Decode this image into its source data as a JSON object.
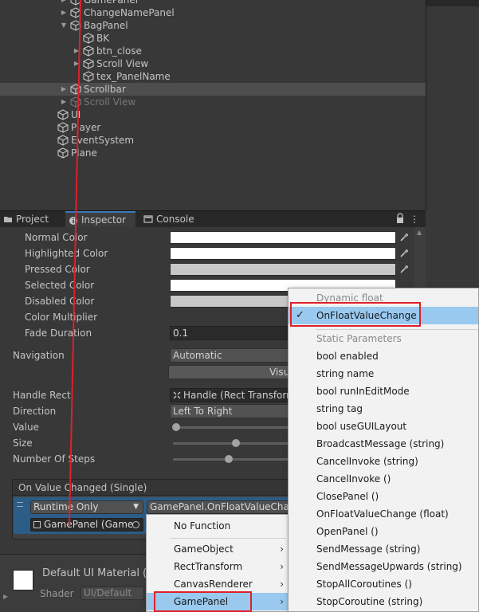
{
  "hierarchy": {
    "items": [
      {
        "label": "GamePanel",
        "indent": 1,
        "arrow": "collapsed",
        "state": "normal"
      },
      {
        "label": "ChangeNamePanel",
        "indent": 1,
        "arrow": "collapsed",
        "state": "normal"
      },
      {
        "label": "BagPanel",
        "indent": 1,
        "arrow": "expanded",
        "state": "normal"
      },
      {
        "label": "BK",
        "indent": 2,
        "arrow": "none",
        "state": "normal"
      },
      {
        "label": "btn_close",
        "indent": 2,
        "arrow": "collapsed",
        "state": "normal"
      },
      {
        "label": "Scroll View",
        "indent": 2,
        "arrow": "collapsed",
        "state": "normal"
      },
      {
        "label": "tex_PanelName",
        "indent": 2,
        "arrow": "none",
        "state": "normal"
      },
      {
        "label": "Scrollbar",
        "indent": 1,
        "arrow": "collapsed",
        "state": "selected"
      },
      {
        "label": "Scroll View",
        "indent": 1,
        "arrow": "collapsed",
        "state": "dim"
      },
      {
        "label": "UI",
        "indent": 0,
        "arrow": "none",
        "state": "normal"
      },
      {
        "label": "Player",
        "indent": 0,
        "arrow": "none",
        "state": "normal"
      },
      {
        "label": "EventSystem",
        "indent": 0,
        "arrow": "none",
        "state": "normal"
      },
      {
        "label": "Plane",
        "indent": 0,
        "arrow": "none",
        "state": "normal"
      }
    ]
  },
  "tabs": {
    "project": "Project",
    "inspector": "Inspector",
    "console": "Console",
    "menu_glyph": "⋮"
  },
  "inspector": {
    "normal_color": "Normal Color",
    "highlighted_color": "Highlighted Color",
    "pressed_color": "Pressed Color",
    "selected_color": "Selected Color",
    "disabled_color": "Disabled Color",
    "color_multiplier": "Color Multiplier",
    "fade_duration": "Fade Duration",
    "fade_duration_value": "0.1",
    "navigation": "Navigation",
    "navigation_value": "Automatic",
    "visualize_button": "Visualize",
    "handle_rect": "Handle Rect",
    "handle_rect_value": "Handle (Rect Transform)",
    "direction": "Direction",
    "direction_value": "Left To Right",
    "value_label": "Value",
    "size_label": "Size",
    "steps_label": "Number Of Steps",
    "slider_value": 0.0,
    "slider_size": 0.25,
    "slider_steps": 0.22,
    "event_header": "On Value Changed (Single)",
    "runtime_value": "Runtime Only",
    "function_value": "GamePanel.OnFloatValueChange",
    "object_value": "GamePanel (Game",
    "material_name": "Default UI Material (M",
    "shader_label": "Shader",
    "shader_value": "UI/Default"
  },
  "main_menu": {
    "no_function": "No Function",
    "items": [
      "GameObject",
      "RectTransform",
      "CanvasRenderer",
      "GamePanel"
    ],
    "arrow_glyph": "›"
  },
  "sub_menu": {
    "dynamic_header": "Dynamic float",
    "dynamic_item": "OnFloatValueChange",
    "check_glyph": "✓",
    "static_header": "Static Parameters",
    "static_items": [
      "bool enabled",
      "string name",
      "bool runInEditMode",
      "string tag",
      "bool useGUILayout",
      "BroadcastMessage (string)",
      "CancelInvoke (string)",
      "CancelInvoke ()",
      "ClosePanel ()",
      "OnFloatValueChange (float)",
      "OpenPanel ()",
      "SendMessage (string)",
      "SendMessageUpwards (string)",
      "StopAllCoroutines ()",
      "StopCoroutine (string)"
    ]
  },
  "colors": {
    "highlight": "#99c9ef",
    "annotation_red": "#e0202a",
    "selection_blue": "#2c5d87",
    "tab_accent": "#3a79bb"
  }
}
